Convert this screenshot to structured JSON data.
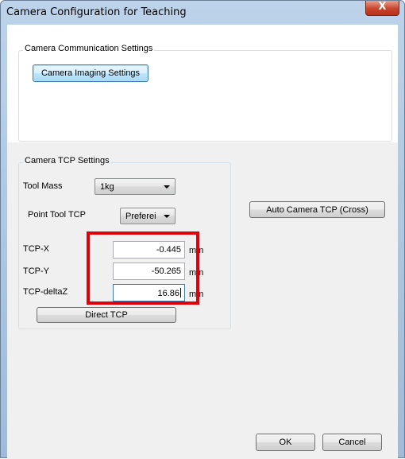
{
  "window": {
    "title": "Camera Configuration for Teaching",
    "close_glyph": "X"
  },
  "comm_group": {
    "title": "Camera Communication Settings",
    "imaging_button": "Camera Imaging Settings"
  },
  "tcp_group": {
    "title": "Camera TCP Settings",
    "tool_mass": {
      "label": "Tool Mass",
      "value": "1kg"
    },
    "point_tool": {
      "label": "Point Tool TCP",
      "value": "Preferei"
    },
    "fields": [
      {
        "label": "TCP-X",
        "value": "-0.445",
        "unit": "mm"
      },
      {
        "label": "TCP-Y",
        "value": "-50.265",
        "unit": "mm"
      },
      {
        "label": "TCP-deltaZ",
        "value": "16.86",
        "unit": "mm"
      }
    ],
    "direct_button": "Direct TCP"
  },
  "auto_button": "Auto Camera TCP (Cross)",
  "footer": {
    "ok": "OK",
    "cancel": "Cancel"
  },
  "colors": {
    "highlight": "#e0000b",
    "close_red": "#c8442b",
    "title_blue": "#bcd3ea"
  },
  "icons": [
    "close-icon",
    "dropdown-arrow-icon"
  ]
}
